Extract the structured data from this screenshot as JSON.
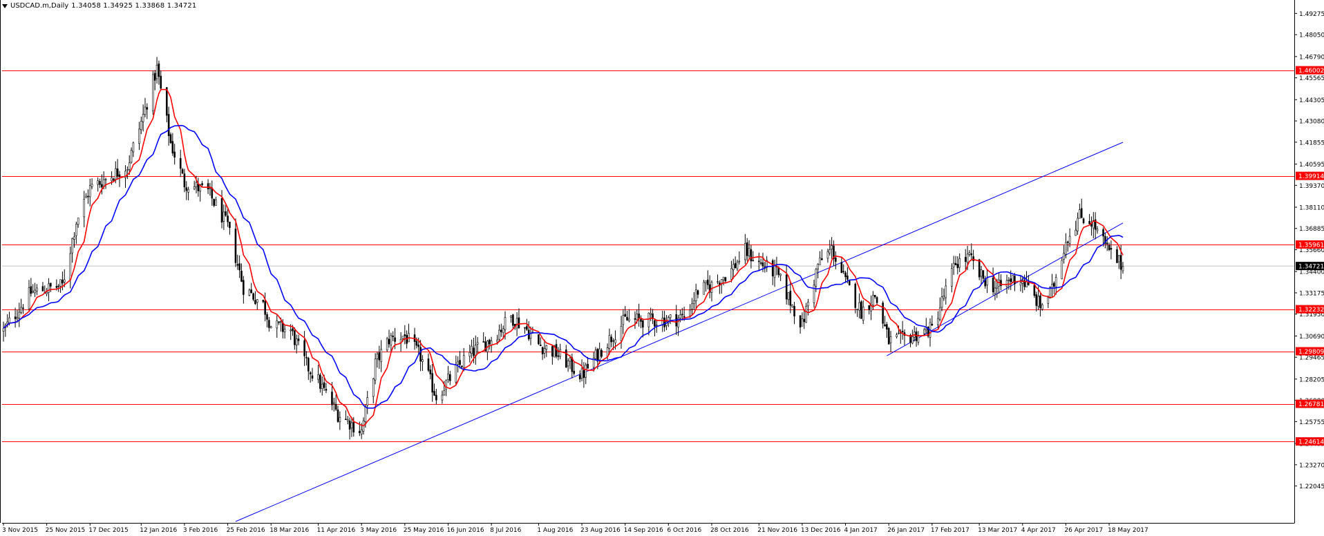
{
  "header": {
    "symbol": "USDCAD.m,Daily",
    "ohlc": "1.34058 1.34925 1.33868 1.34721"
  },
  "colors": {
    "candle": "#000000",
    "hline": "#ff0000",
    "channel": "#0000ff",
    "ema_fast": "#ff0000",
    "ema_slow": "#0000ff",
    "bid_line": "#c0c0c0",
    "axis": "#000000"
  },
  "chart_data": {
    "type": "candlestick",
    "symbol": "USDCAD.m",
    "timeframe": "Daily",
    "ylim": [
      1.2,
      1.5
    ],
    "y_ticks": [
      1.49275,
      1.4805,
      1.4679,
      1.45565,
      1.44305,
      1.4308,
      1.41855,
      1.40595,
      1.3937,
      1.3811,
      1.36885,
      1.3566,
      1.344,
      1.33175,
      1.3195,
      1.3069,
      1.29465,
      1.28205,
      1.2698,
      1.25755,
      1.24495,
      1.2327,
      1.22045
    ],
    "y_tick_labels": [
      "1.49275",
      "1.48050",
      "1.46790",
      "1.45565",
      "1.44305",
      "1.43080",
      "1.41855",
      "1.40595",
      "1.39370",
      "1.38110",
      "1.36885",
      "1.35660",
      "1.34400",
      "1.33175",
      "1.31950",
      "1.30690",
      "1.29465",
      "1.28205",
      "1.26980",
      "1.25755",
      "1.24495",
      "1.23270",
      "1.22045"
    ],
    "x_labels": [
      "3 Nov 2015",
      "25 Nov 2015",
      "17 Dec 2015",
      "12 Jan 2016",
      "3 Feb 2016",
      "25 Feb 2016",
      "18 Mar 2016",
      "11 Apr 2016",
      "3 May 2016",
      "25 May 2016",
      "16 Jun 2016",
      "8 Jul 2016",
      "1 Aug 2016",
      "23 Aug 2016",
      "14 Sep 2016",
      "6 Oct 2016",
      "28 Oct 2016",
      "21 Nov 2016",
      "13 Dec 2016",
      "4 Jan 2017",
      "26 Jan 2017",
      "17 Feb 2017",
      "13 Mar 2017",
      "4 Apr 2017",
      "26 Apr 2017",
      "18 May 2017"
    ],
    "horizontal_levels": [
      1.46002,
      1.39914,
      1.35961,
      1.32232,
      1.29809,
      1.26781,
      1.24614
    ],
    "horizontal_level_labels": [
      "1.46002",
      "1.39914",
      "1.35961",
      "1.32232",
      "1.29809",
      "1.26781",
      "1.24614"
    ],
    "current_price": 1.34721,
    "current_price_label": "1.34721",
    "channel_lines": [
      {
        "x1": "29 Feb 2016",
        "y1": 1.2,
        "x2": "25 May 2017",
        "y2": 1.4185
      },
      {
        "x1": "25 Jan 2017",
        "y1": 1.2955,
        "x2": "25 May 2017",
        "y2": 1.372
      }
    ],
    "price_path": [
      [
        "3 Nov 2015",
        1.31
      ],
      [
        "17 Nov 2015",
        1.332
      ],
      [
        "3 Dec 2015",
        1.336
      ],
      [
        "10 Dec 2015",
        1.373
      ],
      [
        "17 Dec 2015",
        1.392
      ],
      [
        "5 Jan 2016",
        1.405
      ],
      [
        "12 Jan 2016",
        1.43
      ],
      [
        "20 Jan 2016",
        1.461
      ],
      [
        "27 Jan 2016",
        1.418
      ],
      [
        "3 Feb 2016",
        1.395
      ],
      [
        "15 Feb 2016",
        1.39
      ],
      [
        "25 Feb 2016",
        1.37
      ],
      [
        "4 Mar 2016",
        1.335
      ],
      [
        "14 Mar 2016",
        1.325
      ],
      [
        "18 Mar 2016",
        1.313
      ],
      [
        "28 Mar 2016",
        1.31
      ],
      [
        "5 Apr 2016",
        1.29
      ],
      [
        "11 Apr 2016",
        1.281
      ],
      [
        "21 Apr 2016",
        1.262
      ],
      [
        "3 May 2016",
        1.252
      ],
      [
        "10 May 2016",
        1.291
      ],
      [
        "17 May 2016",
        1.305
      ],
      [
        "25 May 2016",
        1.307
      ],
      [
        "2 Jun 2016",
        1.295
      ],
      [
        "10 Jun 2016",
        1.272
      ],
      [
        "16 Jun 2016",
        1.281
      ],
      [
        "24 Jun 2016",
        1.293
      ],
      [
        "30 Jun 2016",
        1.299
      ],
      [
        "8 Jul 2016",
        1.305
      ],
      [
        "18 Jul 2016",
        1.318
      ],
      [
        "25 Jul 2016",
        1.312
      ],
      [
        "1 Aug 2016",
        1.302
      ],
      [
        "10 Aug 2016",
        1.297
      ],
      [
        "23 Aug 2016",
        1.284
      ],
      [
        "1 Sep 2016",
        1.298
      ],
      [
        "14 Sep 2016",
        1.316
      ],
      [
        "22 Sep 2016",
        1.316
      ],
      [
        "6 Oct 2016",
        1.316
      ],
      [
        "14 Oct 2016",
        1.318
      ],
      [
        "21 Oct 2016",
        1.333
      ],
      [
        "28 Oct 2016",
        1.336
      ],
      [
        "7 Nov 2016",
        1.345
      ],
      [
        "14 Nov 2016",
        1.356
      ],
      [
        "21 Nov 2016",
        1.349
      ],
      [
        "30 Nov 2016",
        1.343
      ],
      [
        "6 Dec 2016",
        1.329
      ],
      [
        "13 Dec 2016",
        1.313
      ],
      [
        "21 Dec 2016",
        1.348
      ],
      [
        "28 Dec 2016",
        1.357
      ],
      [
        "4 Jan 2017",
        1.338
      ],
      [
        "12 Jan 2017",
        1.321
      ],
      [
        "19 Jan 2017",
        1.33
      ],
      [
        "26 Jan 2017",
        1.304
      ],
      [
        "2 Feb 2017",
        1.305
      ],
      [
        "17 Feb 2017",
        1.311
      ],
      [
        "1 Mar 2017",
        1.349
      ],
      [
        "8 Mar 2017",
        1.352
      ],
      [
        "13 Mar 2017",
        1.342
      ],
      [
        "22 Mar 2017",
        1.334
      ],
      [
        "30 Mar 2017",
        1.34
      ],
      [
        "4 Apr 2017",
        1.339
      ],
      [
        "13 Apr 2017",
        1.324
      ],
      [
        "19 Apr 2017",
        1.333
      ],
      [
        "26 Apr 2017",
        1.362
      ],
      [
        "3 May 2017",
        1.376
      ],
      [
        "9 May 2017",
        1.373
      ],
      [
        "18 May 2017",
        1.355
      ],
      [
        "25 May 2017",
        1.347
      ]
    ],
    "moving_averages": [
      {
        "color": "red",
        "type": "fast"
      },
      {
        "color": "blue",
        "type": "slow"
      }
    ],
    "grid": false
  }
}
